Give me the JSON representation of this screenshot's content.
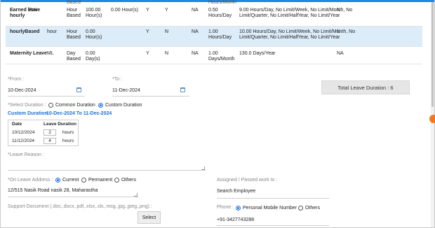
{
  "leave_table": {
    "top_cut": {
      "text": "Based",
      "tail": "Hours/Month"
    },
    "rows": [
      {
        "name": "Earned leave hourly",
        "code": "ELH",
        "type": "Hour Based",
        "days": "100.00 Hour(s)",
        "hours": "0.00 Hour(s)",
        "y1": "Y",
        "y2": "Y",
        "na": "NA",
        "rate": "0.50 Hours/Day",
        "limits": "9.00 Hours/Day, No Limit/Week, No Limit/Month, No Limit/Quarter, No Limit/HalfYear, No Limit/Year",
        "last": "N"
      },
      {
        "name": "hourlyBased",
        "code": "hour",
        "type": "Hour Based",
        "days": "0.00 Hour(s)",
        "hours": "",
        "y1": "Y",
        "y2": "N",
        "na": "NA",
        "rate": "1.00 Hours/Day",
        "limits": "10.00 Hours/Day, No Limit/Week, No Limit/Month, No Limit/Quarter, No Limit/HalfYear, No Limit/Year",
        "last": "N"
      },
      {
        "name": "Maternity Leave",
        "code": "ML",
        "type": "Day Based",
        "days": "0.00 Day(s)",
        "hours": "",
        "y1": "Y",
        "y2": "N",
        "na": "NA",
        "rate": "1.00 Days/Month",
        "limits": "130.0 Days/Year",
        "last": "NA"
      }
    ]
  },
  "form": {
    "from_label": "*From :",
    "from_value": "10-Dec-2024",
    "to_label": "*To :",
    "to_value": "11-Dec-2024",
    "total_leave_duration": "Total Leave Duration : 6",
    "select_duration_label": "*Select Duration :",
    "duration_options": [
      "Common Duration",
      "Custom Duration"
    ],
    "custom_duration_label": "Custom Duration",
    "custom_duration_range": "10-Dec-2024 To 11-Dec-2024",
    "duration_table": {
      "headers": [
        "Date",
        "Leave Duration"
      ],
      "rows": [
        {
          "date": "10/12/2024",
          "value": "2",
          "unit": "hours"
        },
        {
          "date": "11/12/2024",
          "value": "4",
          "unit": "hours"
        }
      ]
    },
    "leave_reason_label": "*Leave Reason :",
    "leave_reason_value": "",
    "on_leave_address_label": "*On Leave Address :",
    "address_options": [
      "Current",
      "Permanent",
      "Others"
    ],
    "address_value": "12/515 Nasik Road nasik 28, Maharastha",
    "assigned_label": "Assigned / Passed work to :",
    "assigned_value": "Search Employee",
    "support_doc_label": "Support Document (.doc,.docx,.pdf,.xlsx,.xls,.msg,.jpg,.jpeg,.png) :",
    "select_button": "Select",
    "phone_label": "Phone :",
    "phone_options": [
      "Personal Mobile Number",
      "Others"
    ],
    "phone_value": "+91-3427743288"
  }
}
